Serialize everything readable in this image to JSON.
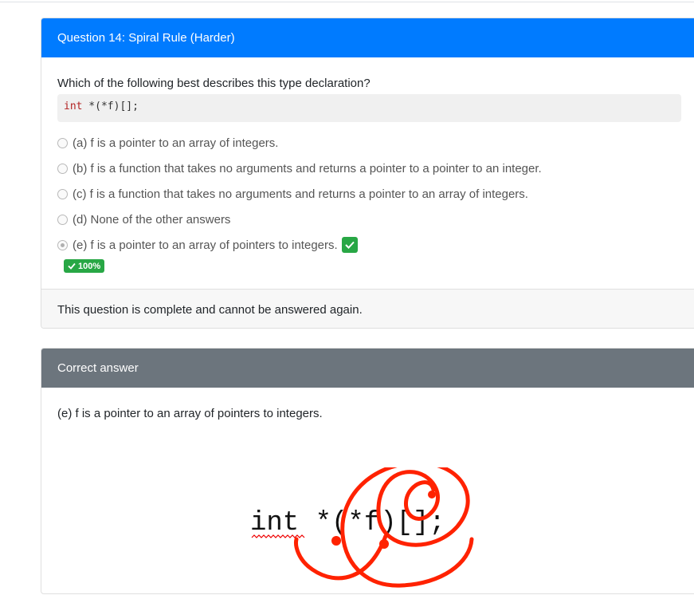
{
  "question": {
    "title": "Question 14: Spiral Rule (Harder)",
    "prompt": "Which of the following best describes this type declaration?",
    "code_keyword": "int",
    "code_rest": " *(*f)[];",
    "options": [
      {
        "label": "(a) f is a pointer to an array of integers.",
        "selected": false
      },
      {
        "label": "(b) f is a function that takes no arguments and returns a pointer to a pointer to an integer.",
        "selected": false
      },
      {
        "label": "(c) f is a function that takes no arguments and returns a pointer to an array of integers.",
        "selected": false
      },
      {
        "label": "(d) None of the other answers",
        "selected": false
      },
      {
        "label": "(e) f is a pointer to an array of pointers to integers.",
        "selected": true,
        "correct": true
      }
    ],
    "score": "100%",
    "footer": "This question is complete and cannot be answered again."
  },
  "answer": {
    "header": "Correct answer",
    "text": "(e) f is a pointer to an array of pointers to integers.",
    "figure_code": "int *(*f)[];"
  },
  "colors": {
    "primary": "#007bff",
    "secondary": "#6c757d",
    "success": "#28a745",
    "spiral": "#ff2200"
  },
  "icons": [
    "check-icon",
    "radio-icon"
  ]
}
